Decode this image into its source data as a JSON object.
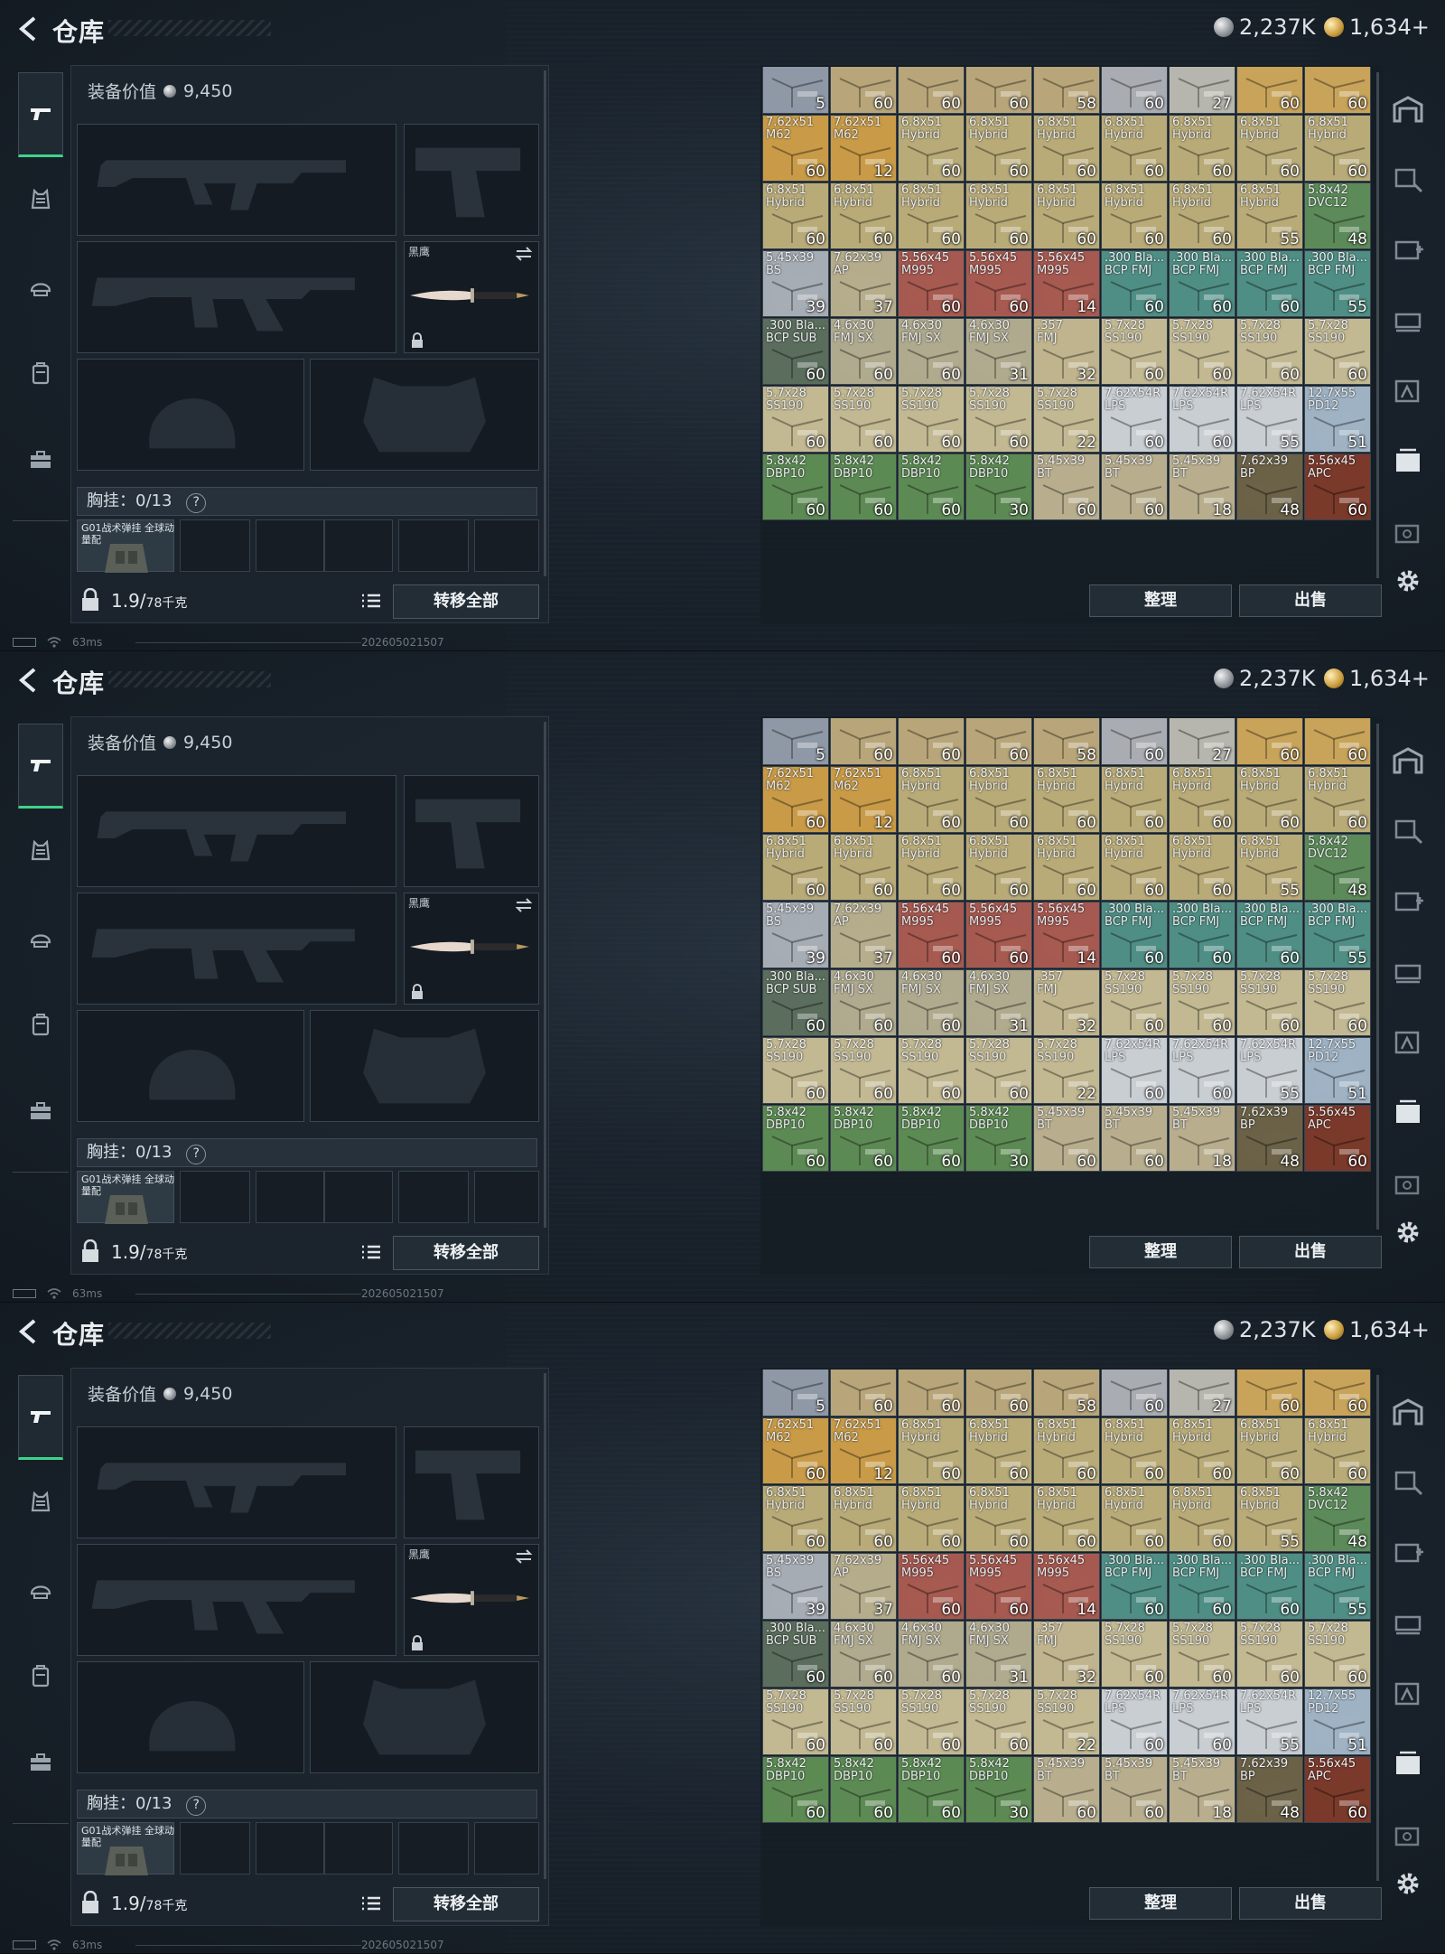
{
  "screens_count": 3,
  "header": {
    "title": "仓库",
    "currency_silver": "2,237K",
    "currency_gold": "1,634+"
  },
  "equipment": {
    "value_label": "装备价值",
    "value": "9,450",
    "melee_label": "黑鹰",
    "rig_label": "胸挂：0/13",
    "rig_help": "?",
    "rig_item_name": "G01战术弹挂 全球动量配",
    "weight_value": "1.9/",
    "weight_unit": "78千克",
    "transfer_all": "转移全部"
  },
  "stash": {
    "sort_button": "整理",
    "sell_button": "出售",
    "items": [
      {
        "name": "",
        "sub": "",
        "qty": "5",
        "color": "#8f99a6"
      },
      {
        "name": "",
        "sub": "",
        "qty": "60",
        "color": "#b8a67a"
      },
      {
        "name": "",
        "sub": "",
        "qty": "60",
        "color": "#b8a67a"
      },
      {
        "name": "",
        "sub": "",
        "qty": "60",
        "color": "#b8a67a"
      },
      {
        "name": "",
        "sub": "",
        "qty": "58",
        "color": "#b8a67a"
      },
      {
        "name": "",
        "sub": "",
        "qty": "60",
        "color": "#a9adb2"
      },
      {
        "name": "",
        "sub": "",
        "qty": "27",
        "color": "#b7b6ae"
      },
      {
        "name": "",
        "sub": "",
        "qty": "60",
        "color": "#c8a45a"
      },
      {
        "name": "",
        "sub": "",
        "qty": "60",
        "color": "#c8a45a"
      },
      {
        "name": "7.62x51",
        "sub": "M62",
        "qty": "60",
        "color": "#c99b48"
      },
      {
        "name": "7.62x51",
        "sub": "M62",
        "qty": "12",
        "color": "#c99b48"
      },
      {
        "name": "6.8x51",
        "sub": "Hybrid",
        "qty": "60",
        "color": "#b9ab78"
      },
      {
        "name": "6.8x51",
        "sub": "Hybrid",
        "qty": "60",
        "color": "#b9ab78"
      },
      {
        "name": "6.8x51",
        "sub": "Hybrid",
        "qty": "60",
        "color": "#b9ab78"
      },
      {
        "name": "6.8x51",
        "sub": "Hybrid",
        "qty": "60",
        "color": "#b9ab78"
      },
      {
        "name": "6.8x51",
        "sub": "Hybrid",
        "qty": "60",
        "color": "#b9ab78"
      },
      {
        "name": "6.8x51",
        "sub": "Hybrid",
        "qty": "60",
        "color": "#b9ab78"
      },
      {
        "name": "6.8x51",
        "sub": "Hybrid",
        "qty": "60",
        "color": "#b9ab78"
      },
      {
        "name": "6.8x51",
        "sub": "Hybrid",
        "qty": "60",
        "color": "#b9ab78"
      },
      {
        "name": "6.8x51",
        "sub": "Hybrid",
        "qty": "60",
        "color": "#b9ab78"
      },
      {
        "name": "6.8x51",
        "sub": "Hybrid",
        "qty": "60",
        "color": "#b9ab78"
      },
      {
        "name": "6.8x51",
        "sub": "Hybrid",
        "qty": "60",
        "color": "#b9ab78"
      },
      {
        "name": "6.8x51",
        "sub": "Hybrid",
        "qty": "60",
        "color": "#b9ab78"
      },
      {
        "name": "6.8x51",
        "sub": "Hybrid",
        "qty": "60",
        "color": "#b9ab78"
      },
      {
        "name": "6.8x51",
        "sub": "Hybrid",
        "qty": "60",
        "color": "#b9ab78"
      },
      {
        "name": "6.8x51",
        "sub": "Hybrid",
        "qty": "55",
        "color": "#b9ab78"
      },
      {
        "name": "5.8x42",
        "sub": "DVC12",
        "qty": "48",
        "color": "#5c8a5a"
      },
      {
        "name": "5.45x39",
        "sub": "BS",
        "qty": "39",
        "color": "#a7adb4"
      },
      {
        "name": "7.62x39",
        "sub": "AP",
        "qty": "37",
        "color": "#b5ad8c"
      },
      {
        "name": "5.56x45",
        "sub": "M995",
        "qty": "60",
        "color": "#a65a50"
      },
      {
        "name": "5.56x45",
        "sub": "M995",
        "qty": "60",
        "color": "#a65a50"
      },
      {
        "name": "5.56x45",
        "sub": "M995",
        "qty": "14",
        "color": "#a65a50"
      },
      {
        "name": ".300 Bla...",
        "sub": "BCP FMJ",
        "qty": "60",
        "color": "#4f8e84"
      },
      {
        "name": ".300 Bla...",
        "sub": "BCP FMJ",
        "qty": "60",
        "color": "#4f8e84"
      },
      {
        "name": ".300 Bla...",
        "sub": "BCP FMJ",
        "qty": "60",
        "color": "#4f8e84"
      },
      {
        "name": ".300 Bla...",
        "sub": "BCP FMJ",
        "qty": "55",
        "color": "#4f8e84"
      },
      {
        "name": ".300 Bla...",
        "sub": "BCP SUB",
        "qty": "60",
        "color": "#5b6e5d"
      },
      {
        "name": "4.6x30",
        "sub": "FMJ SX",
        "qty": "60",
        "color": "#b0aa8e"
      },
      {
        "name": "4.6x30",
        "sub": "FMJ SX",
        "qty": "60",
        "color": "#b0aa8e"
      },
      {
        "name": "4.6x30",
        "sub": "FMJ SX",
        "qty": "31",
        "color": "#b0aa8e"
      },
      {
        "name": ".357",
        "sub": "FMJ",
        "qty": "32",
        "color": "#c0b48e"
      },
      {
        "name": "5.7x28",
        "sub": "SS190",
        "qty": "60",
        "color": "#c2b892"
      },
      {
        "name": "5.7x28",
        "sub": "SS190",
        "qty": "60",
        "color": "#c2b892"
      },
      {
        "name": "5.7x28",
        "sub": "SS190",
        "qty": "60",
        "color": "#c2b892"
      },
      {
        "name": "5.7x28",
        "sub": "SS190",
        "qty": "60",
        "color": "#c2b892"
      },
      {
        "name": "5.7x28",
        "sub": "SS190",
        "qty": "60",
        "color": "#c2b892"
      },
      {
        "name": "5.7x28",
        "sub": "SS190",
        "qty": "60",
        "color": "#c2b892"
      },
      {
        "name": "5.7x28",
        "sub": "SS190",
        "qty": "60",
        "color": "#c2b892"
      },
      {
        "name": "5.7x28",
        "sub": "SS190",
        "qty": "60",
        "color": "#c2b892"
      },
      {
        "name": "5.7x28",
        "sub": "SS190",
        "qty": "22",
        "color": "#c2b892"
      },
      {
        "name": "7.62x54R",
        "sub": "LPS",
        "qty": "60",
        "color": "#c9ced3"
      },
      {
        "name": "7.62x54R",
        "sub": "LPS",
        "qty": "60",
        "color": "#c9ced3"
      },
      {
        "name": "7.62x54R",
        "sub": "LPS",
        "qty": "55",
        "color": "#c9ced3"
      },
      {
        "name": "12.7x55",
        "sub": "PD12",
        "qty": "51",
        "color": "#9fb3c4"
      },
      {
        "name": "5.8x42",
        "sub": "DBP10",
        "qty": "60",
        "color": "#5d8a54"
      },
      {
        "name": "5.8x42",
        "sub": "DBP10",
        "qty": "60",
        "color": "#5d8a54"
      },
      {
        "name": "5.8x42",
        "sub": "DBP10",
        "qty": "60",
        "color": "#5d8a54"
      },
      {
        "name": "5.8x42",
        "sub": "DBP10",
        "qty": "30",
        "color": "#5d8a54"
      },
      {
        "name": "5.45x39",
        "sub": "BT",
        "qty": "60",
        "color": "#b8ae8e"
      },
      {
        "name": "5.45x39",
        "sub": "BT",
        "qty": "60",
        "color": "#b8ae8e"
      },
      {
        "name": "5.45x39",
        "sub": "BT",
        "qty": "18",
        "color": "#b8ae8e"
      },
      {
        "name": "7.62x39",
        "sub": "BP",
        "qty": "48",
        "color": "#6b6248"
      },
      {
        "name": "5.56x45",
        "sub": "APC",
        "qty": "60",
        "color": "#7a3a2a"
      }
    ]
  },
  "status": {
    "ping": "63ms",
    "build": "202605021507"
  },
  "colors": {
    "accent_green": "#3fd38a",
    "panel_bg": "#1c252e",
    "button_bg": "#232d36"
  }
}
